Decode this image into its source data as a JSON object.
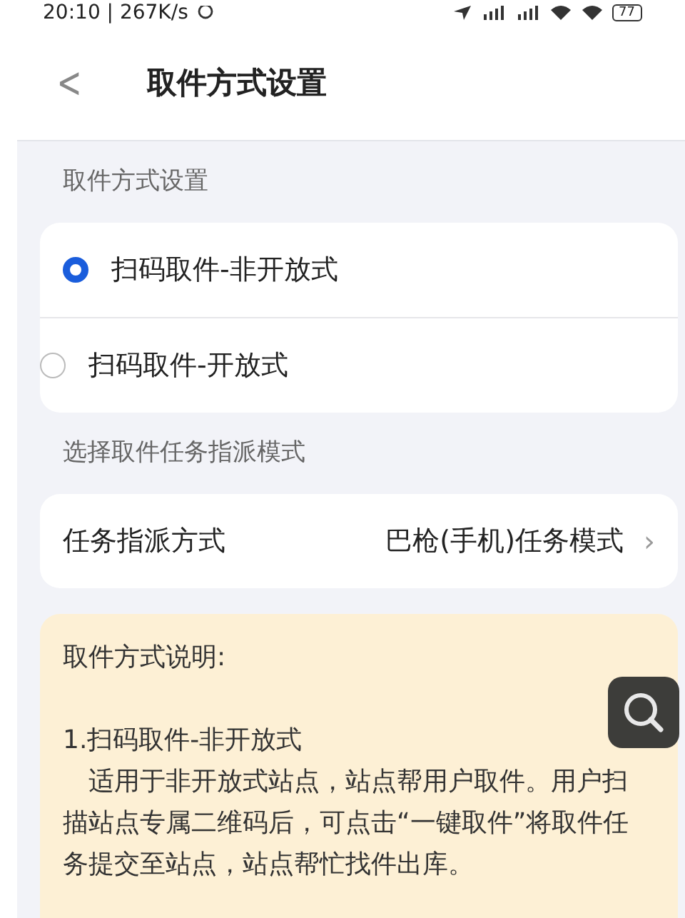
{
  "status_bar": {
    "time": "20:10 | 267K/s",
    "battery": "77"
  },
  "header": {
    "back": "<",
    "title": "取件方式设置"
  },
  "pickup_section": {
    "label": "取件方式设置",
    "options": [
      {
        "label": "扫码取件-非开放式",
        "selected": true
      },
      {
        "label": "扫码取件-开放式",
        "selected": false
      }
    ]
  },
  "assign_section": {
    "label": "选择取件任务指派模式",
    "row": {
      "label": "任务指派方式",
      "value": "巴枪(手机)任务模式",
      "chevron": "›"
    }
  },
  "note": {
    "title": "取件方式说明:",
    "item_title": "1.扫码取件-非开放式",
    "item_text": "　适用于非开放式站点，站点帮用户取件。用户扫描站点专属二维码后，可点击“一键取件”将取件任务提交至站点，站点帮忙找件出库。"
  }
}
